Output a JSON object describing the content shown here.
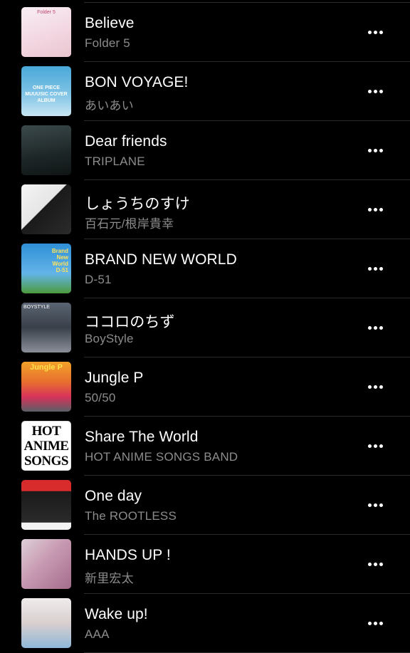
{
  "songs": [
    {
      "title": "Believe",
      "artist": "Folder 5",
      "artwork": {
        "text": "Folder 5",
        "bg": "linear-gradient(160deg,#f7eef3 0%,#f3d7e2 55%,#e9c6cf 100%)",
        "fg": "#c0476b"
      }
    },
    {
      "title": "BON VOYAGE!",
      "artist": "あいあい",
      "artwork": {
        "text": "ONE PIECE MUUUSIC COVER ALBUM",
        "bg": "linear-gradient(180deg,#4aa8d8 0%,#7fc3e6 55%,#c8e6f2 100%)",
        "fg": "#ffffff"
      }
    },
    {
      "title": "Dear friends",
      "artist": "TRIPLANE",
      "artwork": {
        "text": "",
        "bg": "linear-gradient(170deg,#3c4a4c 0%,#1d2627 60%,#101515 100%)",
        "fg": "#d8d8d8"
      }
    },
    {
      "title": "しょうちのすけ",
      "artist": "百石元/根岸貴幸",
      "artwork": {
        "text": "",
        "bg": "linear-gradient(135deg,#f4f4f4 0%,#e6e6e6 45%,#1a1a1a 46%,#2b2b2b 100%)",
        "fg": "#111111"
      }
    },
    {
      "title": "BRAND NEW WORLD",
      "artist": "D-51",
      "artwork": {
        "text": "Brand New World D-51",
        "bg": "linear-gradient(180deg,#2f8fd6 0%,#63b4e8 60%,#4c9a3c 100%)",
        "fg": "#ffe25a"
      }
    },
    {
      "title": "ココロのちず",
      "artist": "BoyStyle",
      "artwork": {
        "text": "BOYSTYLE",
        "bg": "linear-gradient(180deg,#5a6472 0%,#3a404a 50%,#8a8f99 100%)",
        "fg": "#ffffff"
      }
    },
    {
      "title": "Jungle P",
      "artist": "50/50",
      "artwork": {
        "text": "Jungle P",
        "bg": "linear-gradient(180deg,#f2a22a 0%,#e8702e 40%,#d8335a 70%,#5a5f66 100%)",
        "fg": "#ffe14a"
      }
    },
    {
      "title": "Share The World",
      "artist": "HOT ANIME SONGS BAND",
      "artwork": {
        "text": "HOT ANIME SONGS",
        "bg": "#ffffff",
        "fg": "#000000"
      }
    },
    {
      "title": "One day",
      "artist": "The ROOTLESS",
      "artwork": {
        "text": "",
        "bg": "linear-gradient(180deg,#d82b2b 0%,#d82b2b 22%,#1a1a1a 23%,#2a2a2a 85%,#f2f2f2 86%)",
        "fg": "#ffffff"
      }
    },
    {
      "title": "HANDS UP !",
      "artist": "新里宏太",
      "artwork": {
        "text": "",
        "bg": "linear-gradient(135deg,#ddd0d8 0%,#c89ab2 45%,#a46c8c 100%)",
        "fg": "#ffffff"
      }
    },
    {
      "title": "Wake up!",
      "artist": "AAA",
      "artwork": {
        "text": "",
        "bg": "linear-gradient(180deg,#f0ecec 0%,#d9cfcf 50%,#8fb8d8 100%)",
        "fg": "#333333"
      }
    }
  ]
}
